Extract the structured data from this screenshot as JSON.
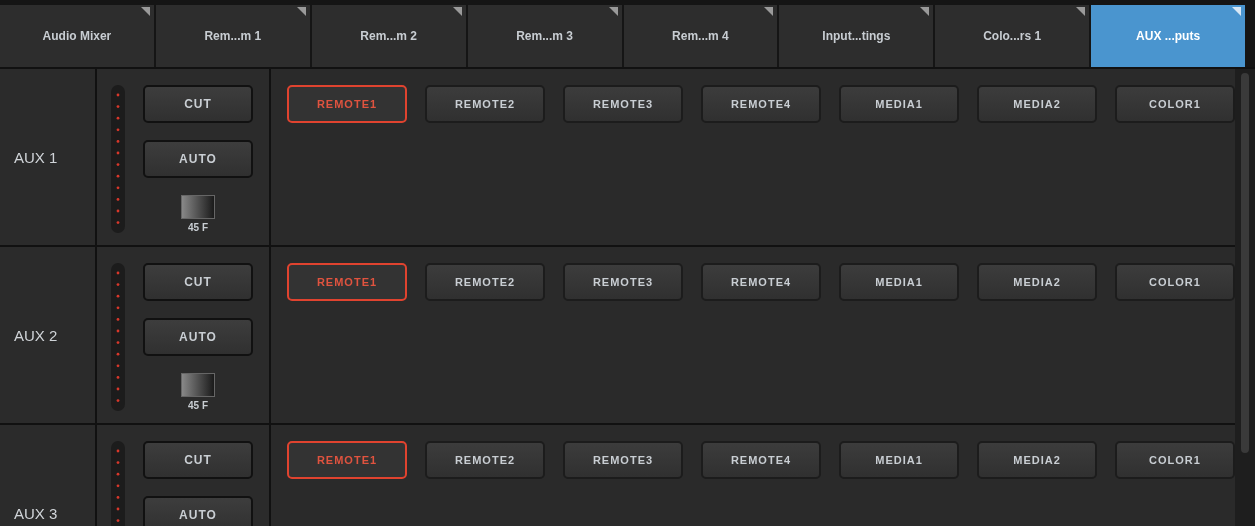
{
  "tabs": [
    {
      "label": "Audio Mixer",
      "selected": false
    },
    {
      "label": "Rem...m 1",
      "selected": false
    },
    {
      "label": "Rem...m 2",
      "selected": false
    },
    {
      "label": "Rem...m 3",
      "selected": false
    },
    {
      "label": "Rem...m 4",
      "selected": false
    },
    {
      "label": "Input...tings",
      "selected": false
    },
    {
      "label": "Colo...rs 1",
      "selected": false
    },
    {
      "label": "AUX ...puts",
      "selected": true
    }
  ],
  "rows": [
    {
      "label": "AUX 1",
      "cut": "CUT",
      "auto": "AUTO",
      "duration": "45 F",
      "sources": [
        {
          "label": "REMOTE1",
          "selected": true
        },
        {
          "label": "REMOTE2",
          "selected": false
        },
        {
          "label": "REMOTE3",
          "selected": false
        },
        {
          "label": "REMOTE4",
          "selected": false
        },
        {
          "label": "MEDIA1",
          "selected": false
        },
        {
          "label": "MEDIA2",
          "selected": false
        },
        {
          "label": "COLOR1",
          "selected": false
        }
      ]
    },
    {
      "label": "AUX 2",
      "cut": "CUT",
      "auto": "AUTO",
      "duration": "45 F",
      "sources": [
        {
          "label": "REMOTE1",
          "selected": true
        },
        {
          "label": "REMOTE2",
          "selected": false
        },
        {
          "label": "REMOTE3",
          "selected": false
        },
        {
          "label": "REMOTE4",
          "selected": false
        },
        {
          "label": "MEDIA1",
          "selected": false
        },
        {
          "label": "MEDIA2",
          "selected": false
        },
        {
          "label": "COLOR1",
          "selected": false
        }
      ]
    },
    {
      "label": "AUX 3",
      "cut": "CUT",
      "auto": "AUTO",
      "sources": [
        {
          "label": "REMOTE1",
          "selected": true
        },
        {
          "label": "REMOTE2",
          "selected": false
        },
        {
          "label": "REMOTE3",
          "selected": false
        },
        {
          "label": "REMOTE4",
          "selected": false
        },
        {
          "label": "MEDIA1",
          "selected": false
        },
        {
          "label": "MEDIA2",
          "selected": false
        },
        {
          "label": "COLOR1",
          "selected": false
        }
      ]
    }
  ]
}
